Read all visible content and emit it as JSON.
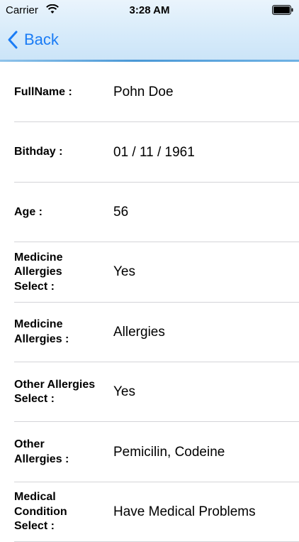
{
  "status_bar": {
    "carrier": "Carrier",
    "time": "3:28 AM",
    "wifi_icon": "wifi-icon",
    "battery_icon": "battery-icon"
  },
  "nav": {
    "back_label": "Back",
    "back_icon": "chevron-left-icon",
    "accent_color": "#1a7cf5"
  },
  "rows": [
    {
      "label": "FullName :",
      "value": "Pohn Doe"
    },
    {
      "label": "Bithday :",
      "value": "01 / 11 / 1961"
    },
    {
      "label": "Age :",
      "value": "56"
    },
    {
      "label": "Medicine\nAllergies\nSelect :",
      "value": "Yes"
    },
    {
      "label": "Medicine\nAllergies :",
      "value": "Allergies"
    },
    {
      "label": "Other Allergies\nSelect :",
      "value": "Yes"
    },
    {
      "label": "Other\nAllergies :",
      "value": "Pemicilin, Codeine"
    },
    {
      "label": "Medical\nCondition\nSelect :",
      "value": "Have Medical Problems"
    }
  ]
}
